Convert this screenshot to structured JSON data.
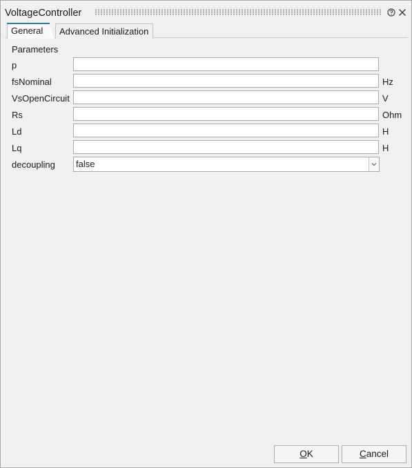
{
  "window": {
    "title": "VoltageController"
  },
  "icons": {
    "help": "help-icon",
    "close": "close-icon"
  },
  "tabs": [
    {
      "label": "General",
      "active": true
    },
    {
      "label": "Advanced Initialization",
      "active": false
    }
  ],
  "section": {
    "label": "Parameters"
  },
  "params": [
    {
      "label": "p",
      "value": "",
      "unit": ""
    },
    {
      "label": "fsNominal",
      "value": "",
      "unit": "Hz"
    },
    {
      "label": "VsOpenCircuit",
      "value": "",
      "unit": "V"
    },
    {
      "label": "Rs",
      "value": "",
      "unit": "Ohm"
    },
    {
      "label": "Ld",
      "value": "",
      "unit": "H"
    },
    {
      "label": "Lq",
      "value": "",
      "unit": "H"
    }
  ],
  "decoupling": {
    "label": "decoupling",
    "value": "false"
  },
  "buttons": {
    "ok": {
      "mnemonic": "O",
      "rest": "K"
    },
    "cancel": {
      "mnemonic": "C",
      "rest": "ancel"
    }
  },
  "colors": {
    "tab_accent": "#2e7d9a",
    "background": "#f0f0f0"
  }
}
